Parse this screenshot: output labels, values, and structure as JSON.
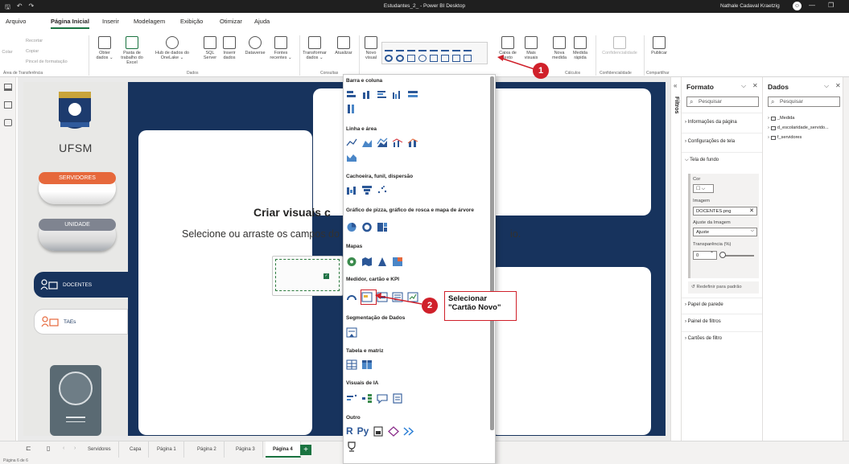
{
  "titlebar": {
    "title": "Estudantes_2_ - Power BI Desktop",
    "user": "Nathale Cadaval Kraetzig",
    "min": "—",
    "restore": "❐",
    "close": "✕"
  },
  "menu": {
    "tabs": [
      "Arquivo",
      "Página Inicial",
      "Inserir",
      "Modelagem",
      "Exibição",
      "Otimizar",
      "Ajuda"
    ]
  },
  "ribbon": {
    "clipboard": {
      "cut": "Recortar",
      "copy": "Copiar",
      "paint": "Pincel de formatação",
      "paste": "Colar",
      "group": "Área de Transferência"
    },
    "get_data": "Obter dados ⌄",
    "excel": "Pasta de trabalho do Excel",
    "onelake": "Hub de dados do OneLake ⌄",
    "sql": "SQL Server",
    "dataverse": "Inserir dados",
    "dataverse2": "Dataverse",
    "sources": "Fontes recentes ⌄",
    "group_data": "Dados",
    "transform": "Transformar dados ⌄",
    "refresh": "Atualizar",
    "group_queries": "Consultas",
    "new_visual": "Novo visual",
    "textbox": "Caixa de texto",
    "more_visuals": "Mais visuais",
    "new_measure": "Nova medida",
    "quick_measure": "Medida rápida",
    "group_calc": "Cálculos",
    "sensitivity": "Confidencialidade",
    "group_sens": "Confidencialidade",
    "publish": "Publicar",
    "group_share": "Compartilhar"
  },
  "report": {
    "logo_text": "UFSM",
    "btn_servidores": "SERVIDORES",
    "btn_unidade": "UNIDADE",
    "nav_docentes": "DOCENTES",
    "nav_taes": "TAEs",
    "empty_title": "Criar visuais c",
    "empty_sub": "Selecione ou arraste os campos do p",
    "empty_sub_end": "io."
  },
  "visual_dropdown": {
    "sections": [
      "Barra e coluna",
      "Linha e área",
      "Cachoeira, funil, dispersão",
      "Gráfico de pizza, gráfico de rosca e mapa de árvore",
      "Mapas",
      "Medidor, cartão e KPI",
      "Segmentação de Dados",
      "Tabela e matriz",
      "Visuais de IA",
      "Outro"
    ],
    "other_r": "R",
    "other_py": "Py"
  },
  "callouts": {
    "step1": "1",
    "step2": "2",
    "label_line1": "Selecionar",
    "label_line2": "\"Cartão Novo\""
  },
  "filters": {
    "label": "Filtros",
    "collapse": "«"
  },
  "format_pane": {
    "title": "Formato",
    "search_placeholder": "Pesquisar",
    "sections": [
      "Informações da página",
      "Configurações de tela",
      "Tela de fundo"
    ],
    "color_label": "Cor",
    "image_label": "Imagem",
    "image_value": "DOCENTES.png",
    "fit_label": "Ajuste da Imagem",
    "fit_value": "Ajuste",
    "transparency_label": "Transparência (%)",
    "transparency_value": "0",
    "reset": "Redefinir para padrão",
    "more_sections": [
      "Papel de parede",
      "Painel de filtros",
      "Cartões de filtro"
    ]
  },
  "data_pane": {
    "title": "Dados",
    "search_placeholder": "Pesquisar",
    "items": [
      "_Medida",
      "d_escolaridade_servido...",
      "f_servidores"
    ]
  },
  "page_tabs": {
    "tabs": [
      "Servidores",
      "Capa",
      "Página 1",
      "Página 2",
      "Página 3",
      "Página 4"
    ],
    "active": "Página 4",
    "add": "+"
  },
  "status": {
    "text": "Página 6 de 6"
  },
  "colors": {
    "accent": "#1a7340",
    "report_bg": "#17335d",
    "callout_red": "#d0202a",
    "servidores_orange": "#e6683b"
  }
}
